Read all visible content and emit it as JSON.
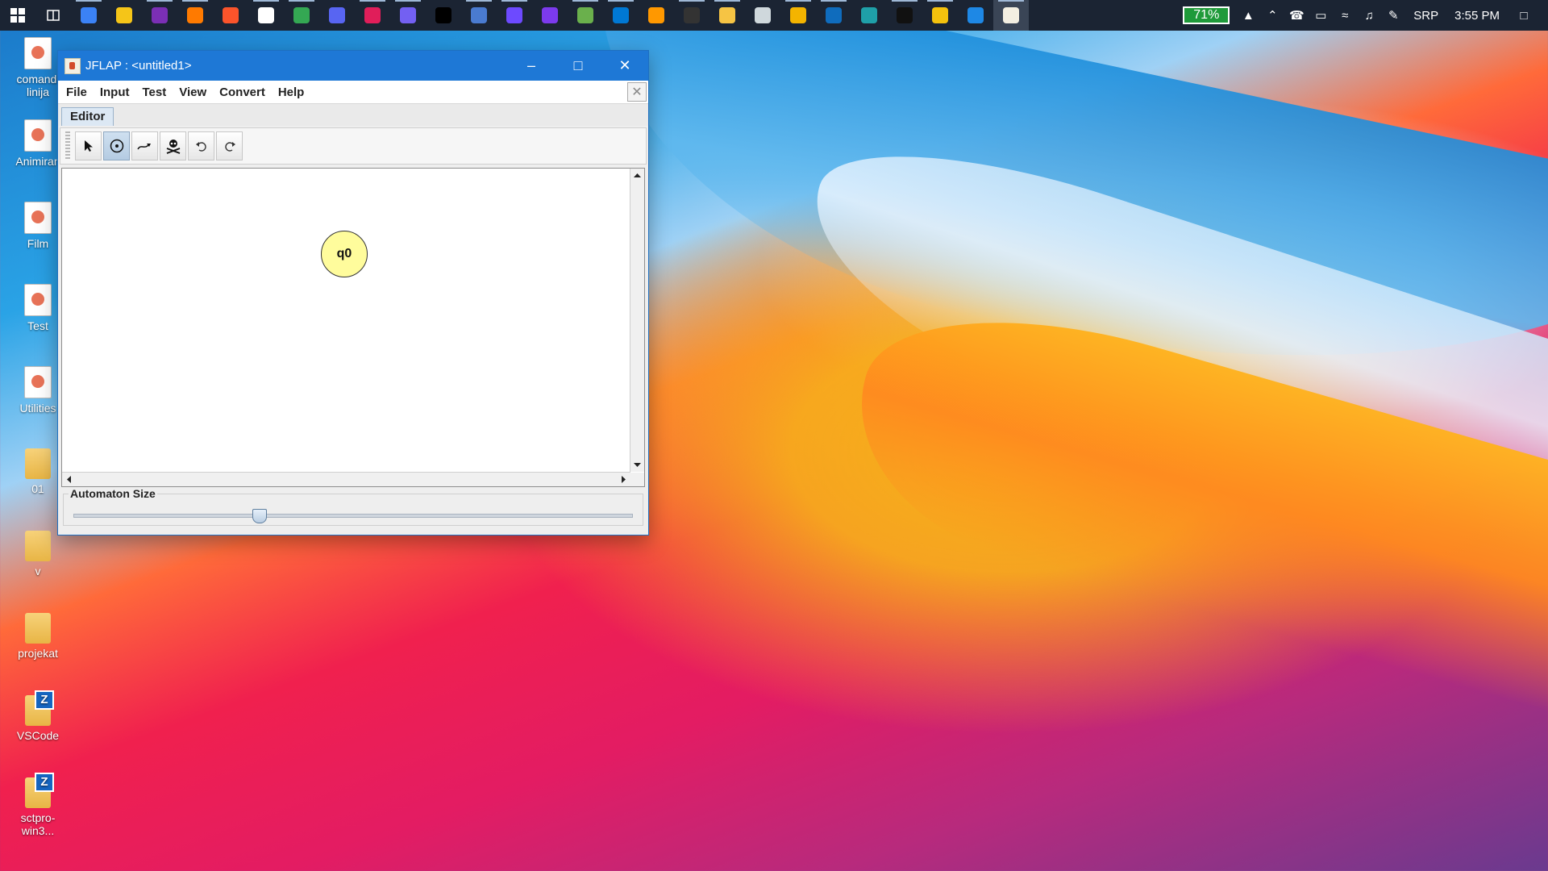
{
  "taskbar": {
    "pinned": [
      {
        "name": "start",
        "color": "#ffffff"
      },
      {
        "name": "task-view",
        "color": "#ffffff"
      },
      {
        "name": "microsoft-todo",
        "color": "#3b82f6"
      },
      {
        "name": "sticky-notes",
        "color": "#f5c518"
      },
      {
        "name": "onenote",
        "color": "#7b2fb5"
      },
      {
        "name": "firefox",
        "color": "#ff7a00"
      },
      {
        "name": "brave",
        "color": "#fb542b"
      },
      {
        "name": "notepad",
        "color": "#ffffff"
      },
      {
        "name": "chrome",
        "color": "#34a853"
      },
      {
        "name": "discord",
        "color": "#5865f2"
      },
      {
        "name": "slack",
        "color": "#e01e5a"
      },
      {
        "name": "viber",
        "color": "#7360f2"
      },
      {
        "name": "intellij",
        "color": "#000000"
      },
      {
        "name": "shield-app",
        "color": "#4a7bd0"
      },
      {
        "name": "proton",
        "color": "#6d4aff"
      },
      {
        "name": "visual-studio",
        "color": "#7c3aed"
      },
      {
        "name": "notepad-plus",
        "color": "#6ab04c"
      },
      {
        "name": "vscode",
        "color": "#0078d4"
      },
      {
        "name": "sublime",
        "color": "#ff9800"
      },
      {
        "name": "obs",
        "color": "#333333"
      },
      {
        "name": "file-explorer",
        "color": "#f6c444"
      },
      {
        "name": "3d-viewer",
        "color": "#cfd8dc"
      },
      {
        "name": "git-app",
        "color": "#f4b400"
      },
      {
        "name": "onedrive",
        "color": "#0f6cbd"
      },
      {
        "name": "edge",
        "color": "#1fa0a8"
      },
      {
        "name": "7zip",
        "color": "#111111"
      },
      {
        "name": "paint",
        "color": "#f4c20d"
      },
      {
        "name": "remote-app",
        "color": "#1e88e5"
      },
      {
        "name": "jflap",
        "color": "#f3efe2"
      }
    ],
    "battery_percent": "71%",
    "language": "SRP",
    "time": "3:55 PM"
  },
  "desktop": {
    "icons": [
      {
        "label": "comandi linija",
        "kind": "doc"
      },
      {
        "label": "Animiran",
        "kind": "doc"
      },
      {
        "label": "Film",
        "kind": "doc"
      },
      {
        "label": "Test",
        "kind": "doc"
      },
      {
        "label": "Utilities",
        "kind": "doc"
      },
      {
        "label": "01",
        "kind": "folder"
      },
      {
        "label": "v",
        "kind": "folder"
      },
      {
        "label": "projekat",
        "kind": "folder"
      },
      {
        "label": "VSCode",
        "kind": "zfolder"
      },
      {
        "label": "sctpro-win3...",
        "kind": "zfolder"
      }
    ]
  },
  "window": {
    "title": "JFLAP : <untitled1>",
    "menu": [
      "File",
      "Input",
      "Test",
      "View",
      "Convert",
      "Help"
    ],
    "tab": "Editor",
    "tools": [
      {
        "name": "attribute-editor",
        "icon": "arrow-pointer-icon",
        "selected": false
      },
      {
        "name": "state-creator",
        "icon": "state-icon",
        "selected": true
      },
      {
        "name": "transition-creator",
        "icon": "transition-arrow-icon",
        "selected": false
      },
      {
        "name": "deleter",
        "icon": "skull-icon",
        "selected": false
      },
      {
        "name": "undo",
        "icon": "undo-icon",
        "selected": false
      },
      {
        "name": "redo",
        "icon": "redo-icon",
        "selected": false
      }
    ],
    "states": [
      {
        "label": "q0"
      }
    ],
    "automaton_size_label": "Automaton Size",
    "automaton_size_value": 0.33
  }
}
